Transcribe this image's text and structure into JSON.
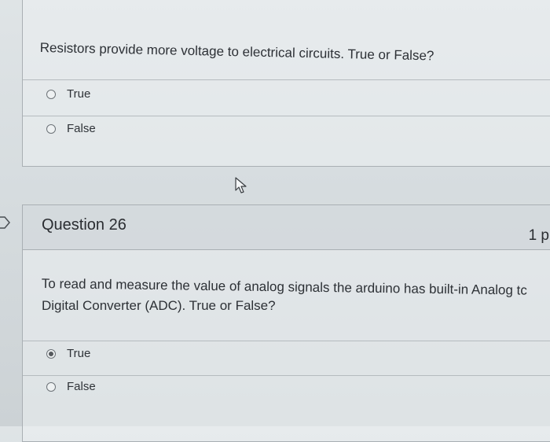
{
  "previous_question": {
    "text": "Resistors provide more voltage to electrical circuits. True or False?",
    "options": [
      {
        "label": "True",
        "selected": false
      },
      {
        "label": "False",
        "selected": false
      }
    ]
  },
  "question_26": {
    "title": "Question 26",
    "points": "1 p",
    "text_line1": "To read and  measure the value of analog signals the arduino has built-in Analog tc",
    "text_line2": "Digital Converter (ADC). True or False?",
    "options": [
      {
        "label": "True",
        "selected": true
      },
      {
        "label": "False",
        "selected": false
      }
    ]
  }
}
